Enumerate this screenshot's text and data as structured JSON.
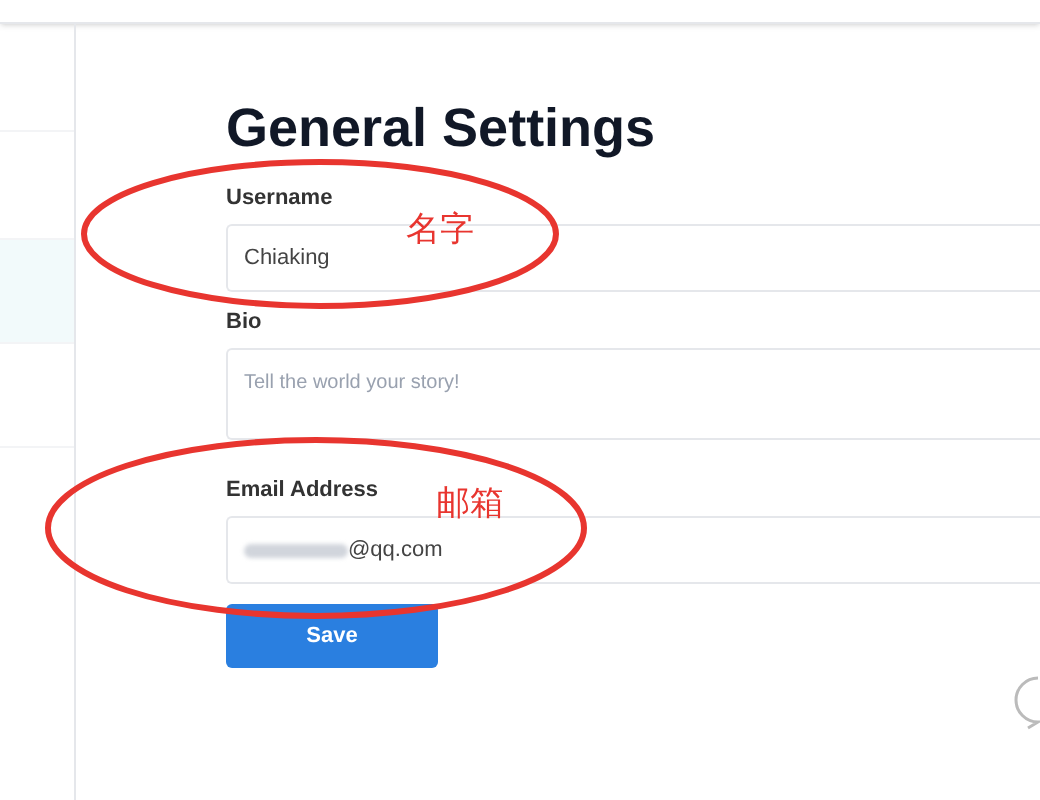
{
  "title": "General Settings",
  "fields": [
    {
      "label": "Username",
      "kind": "input",
      "value": "Chiaking"
    },
    {
      "label": "Bio",
      "kind": "textarea",
      "placeholder": "Tell the world your story!"
    },
    {
      "label": "Email Address",
      "kind": "input",
      "value": "@qq.com",
      "blurred_prefix": true
    }
  ],
  "save_button": "Save",
  "annotations": [
    {
      "text": "名字",
      "color": "#e8352f"
    },
    {
      "text": "邮箱",
      "color": "#e8352f"
    }
  ]
}
